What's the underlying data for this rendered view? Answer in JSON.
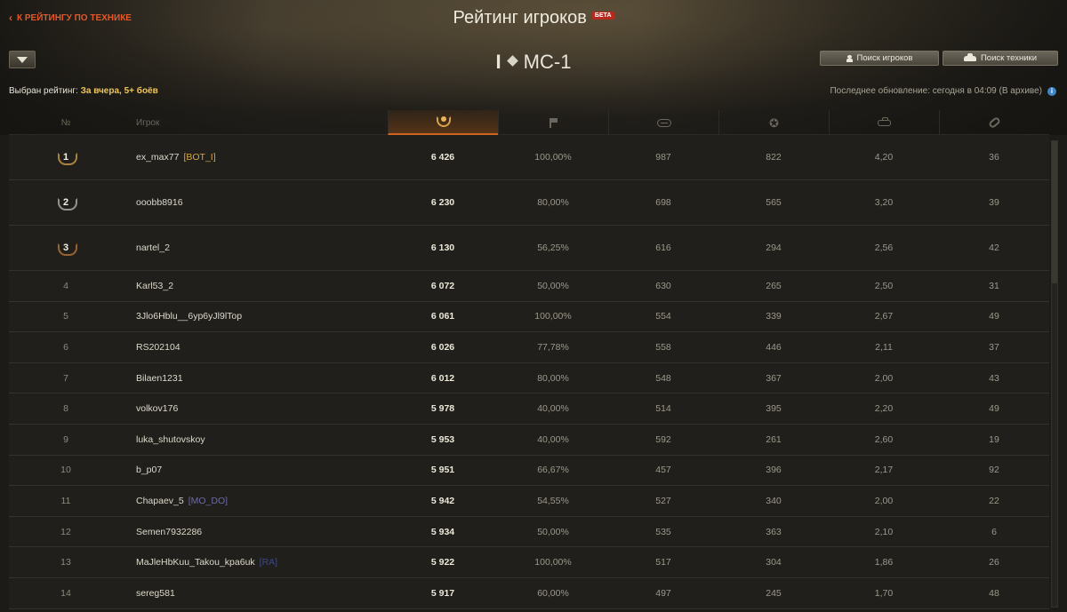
{
  "header": {
    "back_link": "К РЕЙТИНГУ ПО ТЕХНИКЕ",
    "title": "Рейтинг игроков",
    "beta_badge": "БЕТА",
    "vehicle_tier": "I",
    "vehicle_name": "МС-1",
    "selected_rating_label": "Выбран рейтинг:",
    "selected_rating_value": "За вчера, 5+ боёв",
    "search_players": "Поиск игроков",
    "search_vehicles": "Поиск техники",
    "last_update": "Последнее обновление: сегодня в 04:09 (В архиве)",
    "info_icon": "i"
  },
  "columns": {
    "rank": "№",
    "player": "Игрок",
    "rating_icon": "rating-wreath-icon",
    "wins_icon": "flag-icon",
    "damage_icon": "damage-icon",
    "xp_icon": "star-icon",
    "frags_icon": "tank-icon",
    "spotted_icon": "link-icon"
  },
  "rows": [
    {
      "rank": "1",
      "name": "ex_max77",
      "clan": "[BOT_I]",
      "rating": "6 426",
      "wins": "100,00%",
      "damage": "987",
      "xp": "822",
      "frags": "4,20",
      "spotted": "36"
    },
    {
      "rank": "2",
      "name": "ooobb8916",
      "clan": "",
      "rating": "6 230",
      "wins": "80,00%",
      "damage": "698",
      "xp": "565",
      "frags": "3,20",
      "spotted": "39"
    },
    {
      "rank": "3",
      "name": "nartel_2",
      "clan": "",
      "rating": "6 130",
      "wins": "56,25%",
      "damage": "616",
      "xp": "294",
      "frags": "2,56",
      "spotted": "42"
    },
    {
      "rank": "4",
      "name": "Karl53_2",
      "clan": "",
      "rating": "6 072",
      "wins": "50,00%",
      "damage": "630",
      "xp": "265",
      "frags": "2,50",
      "spotted": "31"
    },
    {
      "rank": "5",
      "name": "3Jlo6Hblu__6yp6yJl9lTop",
      "clan": "",
      "rating": "6 061",
      "wins": "100,00%",
      "damage": "554",
      "xp": "339",
      "frags": "2,67",
      "spotted": "49"
    },
    {
      "rank": "6",
      "name": "RS202104",
      "clan": "",
      "rating": "6 026",
      "wins": "77,78%",
      "damage": "558",
      "xp": "446",
      "frags": "2,11",
      "spotted": "37"
    },
    {
      "rank": "7",
      "name": "Bilaen1231",
      "clan": "",
      "rating": "6 012",
      "wins": "80,00%",
      "damage": "548",
      "xp": "367",
      "frags": "2,00",
      "spotted": "43"
    },
    {
      "rank": "8",
      "name": "volkov176",
      "clan": "",
      "rating": "5 978",
      "wins": "40,00%",
      "damage": "514",
      "xp": "395",
      "frags": "2,20",
      "spotted": "49"
    },
    {
      "rank": "9",
      "name": "luka_shutovskoy",
      "clan": "",
      "rating": "5 953",
      "wins": "40,00%",
      "damage": "592",
      "xp": "261",
      "frags": "2,60",
      "spotted": "19"
    },
    {
      "rank": "10",
      "name": "b_p07",
      "clan": "",
      "rating": "5 951",
      "wins": "66,67%",
      "damage": "457",
      "xp": "396",
      "frags": "2,17",
      "spotted": "92"
    },
    {
      "rank": "11",
      "name": "Chapaev_5",
      "clan": "[MO_DO]",
      "rating": "5 942",
      "wins": "54,55%",
      "damage": "527",
      "xp": "340",
      "frags": "2,00",
      "spotted": "22"
    },
    {
      "rank": "12",
      "name": "Semen7932286",
      "clan": "",
      "rating": "5 934",
      "wins": "50,00%",
      "damage": "535",
      "xp": "363",
      "frags": "2,10",
      "spotted": "6"
    },
    {
      "rank": "13",
      "name": "MaJleHbKuu_Takou_kpa6uk",
      "clan": "[RA]",
      "rating": "5 922",
      "wins": "100,00%",
      "damage": "517",
      "xp": "304",
      "frags": "1,86",
      "spotted": "26"
    },
    {
      "rank": "14",
      "name": "sereg581",
      "clan": "",
      "rating": "5 917",
      "wins": "60,00%",
      "damage": "497",
      "xp": "245",
      "frags": "1,70",
      "spotted": "48"
    }
  ],
  "colors": {
    "accent": "#e1582b",
    "rating_highlight": "#f0c55a",
    "clan_bot": "#d6a63e",
    "clan_modo": "#6a6aa6",
    "clan_ra": "#3a4a86"
  }
}
